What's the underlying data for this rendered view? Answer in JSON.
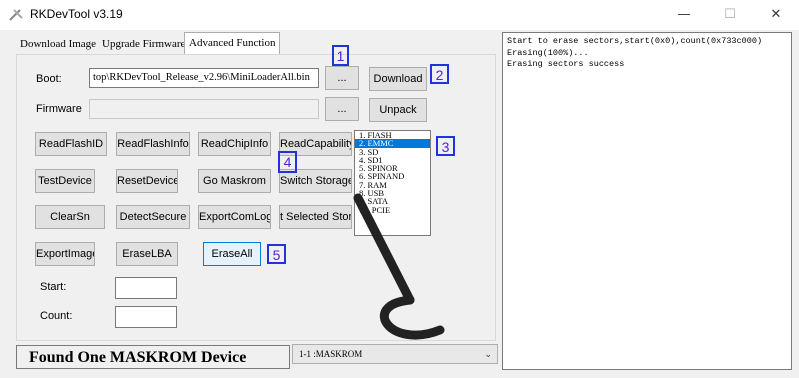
{
  "window": {
    "title": "RKDevTool v3.19",
    "min_glyph": "—",
    "max_glyph": "☐",
    "close_glyph": "✕"
  },
  "tabs": [
    {
      "label": "Download Image",
      "active": false
    },
    {
      "label": "Upgrade Firmware",
      "active": false
    },
    {
      "label": "Advanced Function",
      "active": true
    }
  ],
  "boot": {
    "label": "Boot:",
    "value": "top\\RKDevTool_Release_v2.96\\MiniLoaderAll.bin",
    "browse_label": "...",
    "action_label": "Download"
  },
  "firmware": {
    "label": "Firmware",
    "value": "",
    "browse_label": "...",
    "action_label": "Unpack"
  },
  "buttons": {
    "read_flash_id": "ReadFlashID",
    "read_flash_info": "ReadFlashInfo",
    "read_chip_info": "ReadChipInfo",
    "read_capability": "ReadCapability",
    "test_device": "TestDevice",
    "reset_device": "ResetDevice",
    "go_maskrom": "Go Maskrom",
    "switch_storage": "Switch Storage",
    "clear_sn": "ClearSn",
    "detect_secure": "DetectSecure",
    "export_com_log": "ExportComLog",
    "selected_storage": "t Selected Stora",
    "export_image": "ExportImage",
    "erase_lba": "EraseLBA",
    "erase_all": "EraseAll"
  },
  "storage_list": [
    {
      "label": "1. FlASH",
      "selected": false
    },
    {
      "label": "2. EMMC",
      "selected": true
    },
    {
      "label": "3. SD",
      "selected": false
    },
    {
      "label": "4. SD1",
      "selected": false
    },
    {
      "label": "5. SPINOR",
      "selected": false
    },
    {
      "label": "6. SPINAND",
      "selected": false
    },
    {
      "label": "7. RAM",
      "selected": false
    },
    {
      "label": "8. USB",
      "selected": false
    },
    {
      "label": "9. SATA",
      "selected": false
    },
    {
      "label": "10. PCIE",
      "selected": false
    }
  ],
  "fields": {
    "start_label": "Start:",
    "start_value": "",
    "count_label": "Count:",
    "count_value": ""
  },
  "badges": [
    "1",
    "2",
    "3",
    "4",
    "5"
  ],
  "status": {
    "text": "Found One MASKROM Device",
    "device_option": "1-1 :MASKROM"
  },
  "log_lines": [
    "Start to erase sectors,start(0x0),count(0x733c000)",
    "Erasing(100%)...",
    "Erasing sectors success"
  ],
  "colors": {
    "accent": "#0078d7",
    "badge": "#2233dd",
    "watermark": "#222222"
  }
}
